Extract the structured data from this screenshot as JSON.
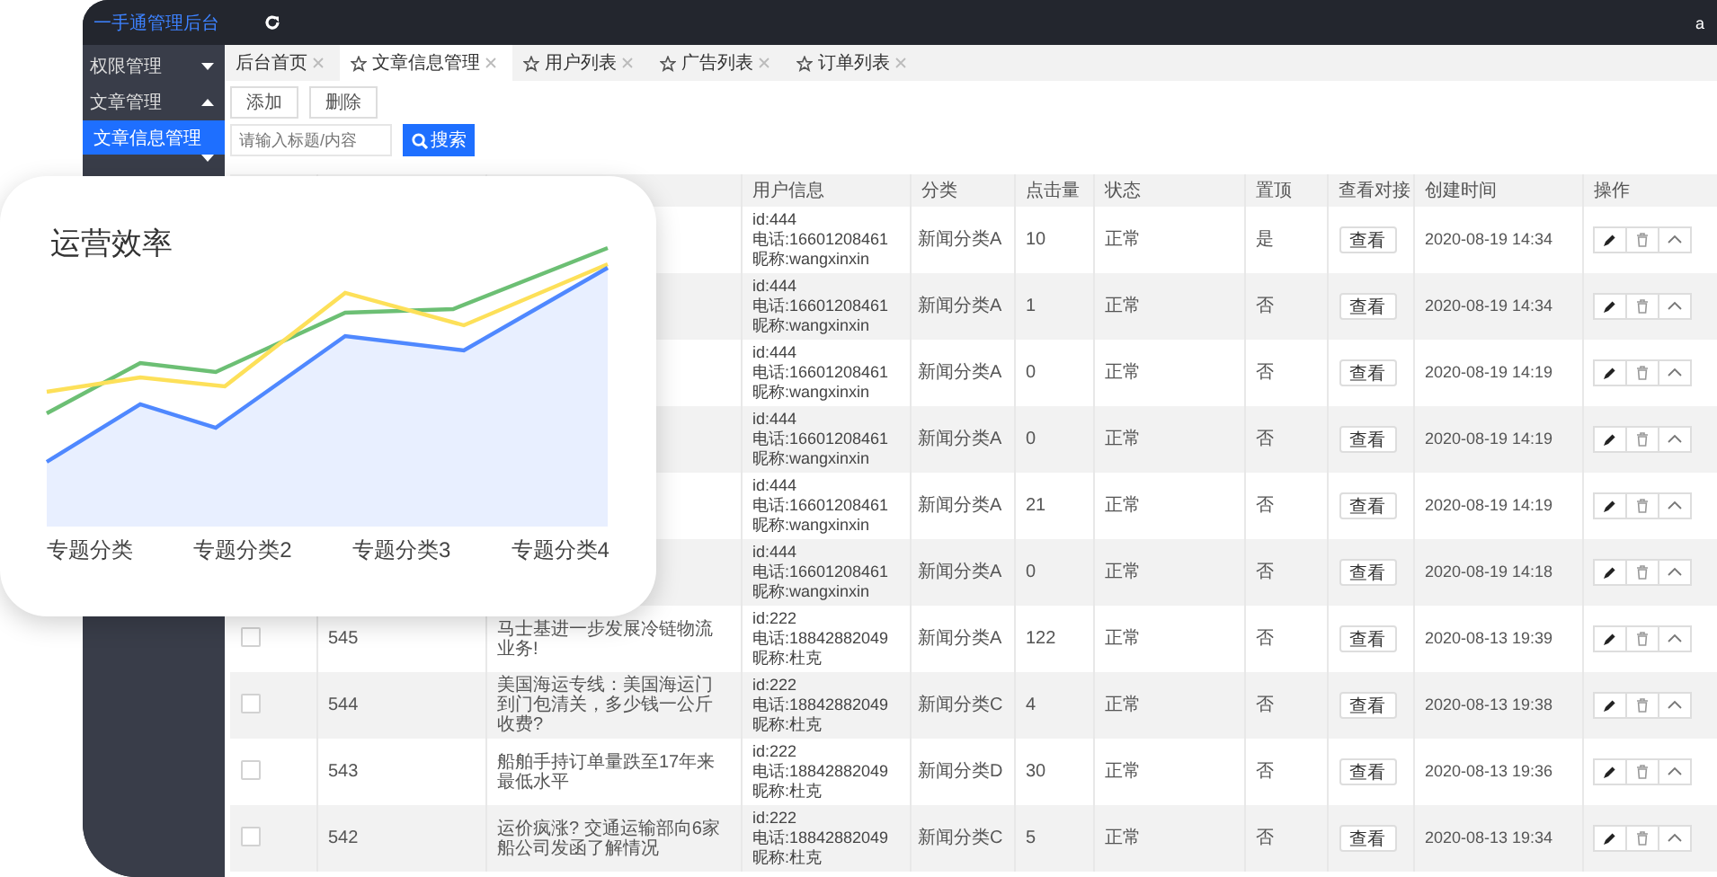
{
  "header": {
    "logo": "一手通管理后台",
    "user": "a"
  },
  "sidebar": {
    "items": [
      {
        "label": "权限管理",
        "expanded": false
      },
      {
        "label": "文章管理",
        "expanded": true,
        "children": [
          {
            "label": "文章信息管理",
            "selected": true
          }
        ]
      },
      {
        "expanded": false
      }
    ]
  },
  "tabs": [
    {
      "label": "后台首页",
      "selected": false,
      "starred": false
    },
    {
      "label": "文章信息管理",
      "selected": true,
      "starred": true
    },
    {
      "label": "用户列表",
      "selected": false,
      "starred": true
    },
    {
      "label": "广告列表",
      "selected": false,
      "starred": true
    },
    {
      "label": "订单列表",
      "selected": false,
      "starred": true
    }
  ],
  "toolbar": {
    "buttons": [
      "添加",
      "删除"
    ],
    "search": {
      "placeholder": "请输入标题/内容",
      "button": "搜索"
    }
  },
  "table": {
    "columns": [
      "用户信息",
      "分类",
      "点击量",
      "状态",
      "置顶",
      "查看对接",
      "创建时间",
      "操作"
    ],
    "rows": [
      {
        "user": [
          "id:444",
          "电话:16601208461",
          "昵称:wangxinxin"
        ],
        "category": "新闻分类A",
        "clicks": "10",
        "status": "正常",
        "top": "是",
        "view": "查看",
        "created": "2020-08-19 14:34"
      },
      {
        "user": [
          "id:444",
          "电话:16601208461",
          "昵称:wangxinxin"
        ],
        "category": "新闻分类A",
        "clicks": "1",
        "status": "正常",
        "top": "否",
        "view": "查看",
        "created": "2020-08-19 14:34"
      },
      {
        "user": [
          "id:444",
          "电话:16601208461",
          "昵称:wangxinxin"
        ],
        "category": "新闻分类A",
        "clicks": "0",
        "status": "正常",
        "top": "否",
        "view": "查看",
        "created": "2020-08-19 14:19"
      },
      {
        "user": [
          "id:444",
          "电话:16601208461",
          "昵称:wangxinxin"
        ],
        "category": "新闻分类A",
        "clicks": "0",
        "status": "正常",
        "top": "否",
        "view": "查看",
        "created": "2020-08-19 14:19"
      },
      {
        "user": [
          "id:444",
          "电话:16601208461",
          "昵称:wangxinxin"
        ],
        "category": "新闻分类A",
        "clicks": "21",
        "status": "正常",
        "top": "否",
        "view": "查看",
        "created": "2020-08-19 14:19"
      },
      {
        "user": [
          "id:444",
          "电话:16601208461",
          "昵称:wangxinxin"
        ],
        "category": "新闻分类A",
        "clicks": "0",
        "status": "正常",
        "top": "否",
        "view": "查看",
        "created": "2020-08-19 14:18"
      },
      {
        "checked": false,
        "id": "545",
        "title": "马士基进一步发展冷链物流业务!",
        "user": [
          "id:222",
          "电话:18842882049",
          "昵称:杜克"
        ],
        "category": "新闻分类A",
        "clicks": "122",
        "status": "正常",
        "top": "否",
        "view": "查看",
        "created": "2020-08-13 19:39"
      },
      {
        "checked": false,
        "id": "544",
        "title": "美国海运专线：美国海运门到门包清关，多少钱一公斤收费?",
        "user": [
          "id:222",
          "电话:18842882049",
          "昵称:杜克"
        ],
        "category": "新闻分类C",
        "clicks": "4",
        "status": "正常",
        "top": "否",
        "view": "查看",
        "created": "2020-08-13 19:38"
      },
      {
        "checked": false,
        "id": "543",
        "title": "船舶手持订单量跌至17年来最低水平",
        "user": [
          "id:222",
          "电话:18842882049",
          "昵称:杜克"
        ],
        "category": "新闻分类D",
        "clicks": "30",
        "status": "正常",
        "top": "否",
        "view": "查看",
        "created": "2020-08-13 19:36"
      },
      {
        "checked": false,
        "id": "542",
        "title": "运价疯涨? 交通运输部向6家船公司发函了解情况",
        "user": [
          "id:222",
          "电话:18842882049",
          "昵称:杜克"
        ],
        "category": "新闻分类C",
        "clicks": "5",
        "status": "正常",
        "top": "否",
        "view": "查看",
        "created": "2020-08-13 19:34"
      }
    ]
  },
  "chart_card": {
    "title": "运营效率",
    "axis_labels": [
      "专题分类",
      "专题分类2",
      "专题分类3",
      "专题分类4"
    ]
  }
}
